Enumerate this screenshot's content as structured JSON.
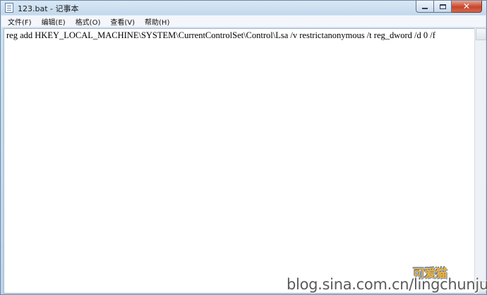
{
  "window": {
    "title": "123.bat - 记事本"
  },
  "menu": [
    {
      "label": "文件(F)"
    },
    {
      "label": "编辑(E)"
    },
    {
      "label": "格式(O)"
    },
    {
      "label": "查看(V)"
    },
    {
      "label": "帮助(H)"
    }
  ],
  "editor": {
    "content": "reg add HKEY_LOCAL_MACHINE\\SYSTEM\\CurrentControlSet\\Control\\Lsa /v restrictanonymous /t reg_dword /d 0 /f"
  },
  "caption_buttons": {
    "minimize_icon": "minimize-icon",
    "maximize_icon": "maximize-icon",
    "close_icon": "close-icon",
    "close_color": "#c7452b"
  },
  "watermark": {
    "logo": "可爱猫",
    "url": "blog.sina.com.cn/lingchunjun"
  }
}
